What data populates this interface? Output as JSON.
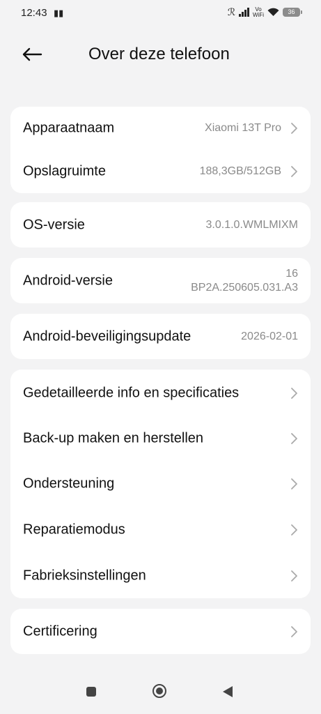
{
  "status_bar": {
    "time": "12:43",
    "battery": "36",
    "vowifi_top": "Vo",
    "vowifi_bottom": "WiFi"
  },
  "header": {
    "title": "Over deze telefoon"
  },
  "card1": [
    {
      "label": "Apparaatnaam",
      "value": "Xiaomi 13T Pro"
    },
    {
      "label": "Opslagruimte",
      "value": "188,3GB/512GB"
    }
  ],
  "card2": {
    "label": "OS-versie",
    "value": "3.0.1.0.WMLMIXM"
  },
  "card3": {
    "label": "Android-versie",
    "value_line1": "16",
    "value_line2": "BP2A.250605.031.A3"
  },
  "card4": {
    "label": "Android-beveiligingsupdate",
    "value": "2026-02-01"
  },
  "card5": [
    {
      "label": "Gedetailleerde info en specificaties"
    },
    {
      "label": "Back-up maken en herstellen"
    },
    {
      "label": "Ondersteuning"
    },
    {
      "label": "Reparatiemodus"
    },
    {
      "label": "Fabrieksinstellingen"
    }
  ],
  "card6": {
    "label": "Certificering"
  }
}
